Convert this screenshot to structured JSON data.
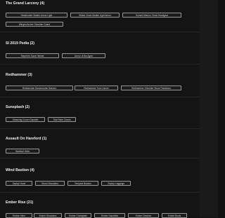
{
  "groups": [
    {
      "name": "The Grand Larceny (4)",
      "chips": [
        "Headhunter Stalker Armor Light",
        "Gilded Chain Mantle Light Armor",
        "Summit Warrior Chest Headgear",
        "Winged Archer Shoulder Guard"
      ]
    },
    {
      "name": "SI 2019 Pedia (2)",
      "chips": [
        "Serpent's Gaze Helmet",
        "Armor of the Aged"
      ]
    },
    {
      "name": "Redhammer (3)",
      "chips": [
        "Redhammer Bonecrusher Bracers",
        "Redhammer Tusk Carver",
        "Redhammer Shoulder Stone Pauldrons"
      ]
    },
    {
      "name": "Sunsplash (2)",
      "chips": [
        "Gleaming Crown Gauntlet",
        "Tide Rider Charm"
      ]
    },
    {
      "name": "Assault On Hareford (1)",
      "chips": [
        "Harefoot Helm"
      ]
    },
    {
      "name": "Wind Bastion (4)",
      "chips": [
        "Zephyr Hood",
        "Storm Shoulders",
        "Tempest Bracers",
        "Zephyr Leggings"
      ]
    },
    {
      "name": "Ember Rise (21)",
      "chips": [
        "Ember Helm",
        "Ember Shoulders",
        "Ember Chestplate",
        "Ember Gauntlets",
        "Ember Greaves",
        "Ember Boots"
      ]
    }
  ]
}
